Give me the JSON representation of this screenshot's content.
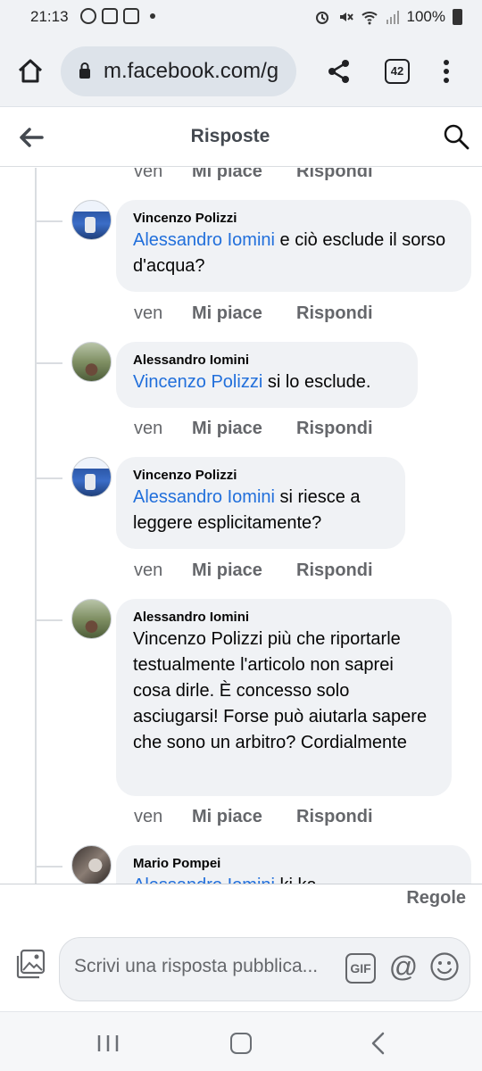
{
  "status_bar": {
    "time": "21:13",
    "battery": "100%"
  },
  "browser": {
    "url": "m.facebook.com/g",
    "tab_count": "42"
  },
  "page": {
    "title": "Risposte"
  },
  "actions": {
    "time": "ven",
    "like": "Mi piace",
    "reply": "Rispondi"
  },
  "comments": [
    {
      "author": "Vincenzo Polizzi",
      "mention": "Alessandro Iomini",
      "text": " e ciò esclude il sorso d'acqua?",
      "avatar": "vincenzo-avatar"
    },
    {
      "author": "Alessandro Iomini",
      "mention": "Vincenzo Polizzi",
      "text": " si lo esclude.",
      "avatar": "alessandro-avatar"
    },
    {
      "author": "Vincenzo Polizzi",
      "mention": "Alessandro Iomini",
      "text": " si riesce a leggere esplicitamente?",
      "avatar": "vincenzo-avatar"
    },
    {
      "author": "Alessandro Iomini",
      "mention": "",
      "text": "Vincenzo Polizzi più che riportarle testualmente l'articolo non saprei cosa dirle. È concesso solo asciugarsi! Forse può aiutarla sapere che sono un arbitro? Cordialmente",
      "avatar": "alessandro-avatar"
    },
    {
      "author": "Mario Pompei",
      "mention": "Alessandro Iomini",
      "text": " ki ka",
      "avatar": "mario-avatar"
    }
  ],
  "compose": {
    "rules_label": "Regole",
    "placeholder": "Scrivi una risposta pubblica...",
    "gif_label": "GIF",
    "at_label": "@"
  },
  "colors": {
    "mention": "#216fdb",
    "bubble": "#f0f2f5",
    "muted": "#65676b"
  }
}
